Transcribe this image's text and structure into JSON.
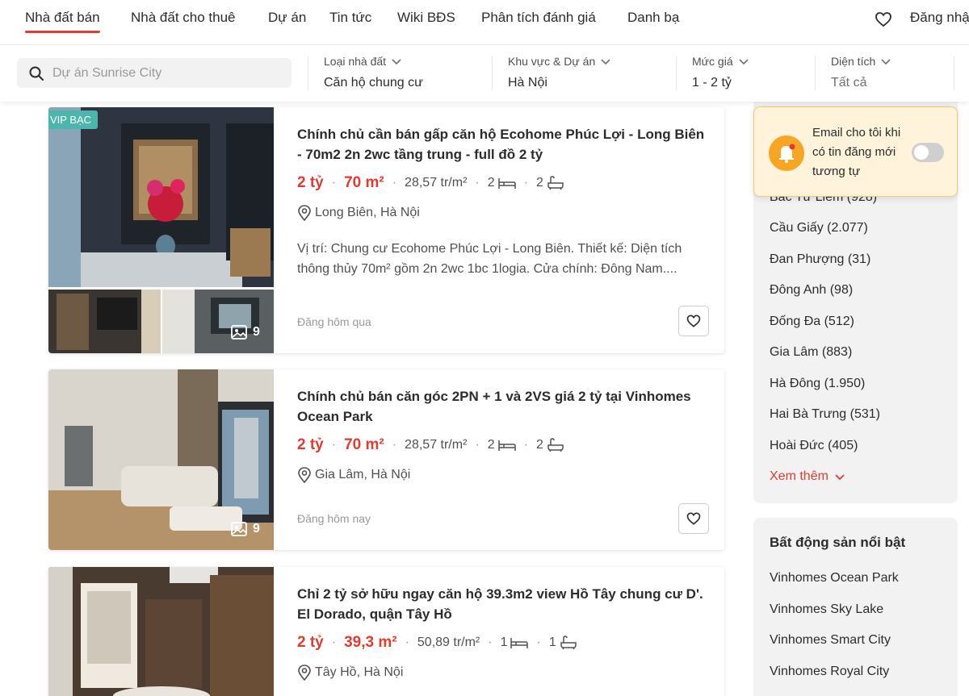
{
  "nav": {
    "items": [
      "Nhà đất bán",
      "Nhà đất cho thuê",
      "Dự án",
      "Tin tức",
      "Wiki BĐS",
      "Phân tích đánh giá",
      "Danh bạ"
    ],
    "active_index": 0,
    "login_label": "Đăng nhậ",
    "heart_icon": "heart-icon"
  },
  "search": {
    "placeholder": "Dự án Sunrise City"
  },
  "filters": [
    {
      "label": "Loại nhà đất",
      "value": "Căn hộ chung cư"
    },
    {
      "label": "Khu vực & Dự án",
      "value": "Hà Nội"
    },
    {
      "label": "Mức giá",
      "value": "1 - 2 tỷ"
    },
    {
      "label": "Diện tích",
      "value": "Tất cả"
    }
  ],
  "listings": [
    {
      "badge": "VIP BẠC",
      "title": "Chính chủ cần bán gấp căn hộ Ecohome Phúc Lợi - Long Biên - 70m2 2n 2wc tầng trung - full đồ 2 tỷ",
      "price": "2 tỷ",
      "area": "70 m²",
      "price_per_m2": "28,57 tr/m²",
      "bedrooms": "2",
      "bathrooms": "2",
      "location": "Long Biên, Hà Nội",
      "description": "Vị trí: Chung cư Ecohome Phúc Lợi - Long Biên. Thiết kế: Diện tích thông thủy 70m² gồm 2n 2wc 1bc 1logia. Cửa chính: Đông Nam....",
      "photo_count": "9",
      "posted": "Đăng hôm qua"
    },
    {
      "title": "Chính chủ bán căn góc 2PN + 1 và 2VS giá 2 tỷ tại Vinhomes Ocean Park",
      "price": "2 tỷ",
      "area": "70 m²",
      "price_per_m2": "28,57 tr/m²",
      "bedrooms": "2",
      "bathrooms": "2",
      "location": "Gia Lâm, Hà Nội",
      "photo_count": "9",
      "posted": "Đăng hôm nay"
    },
    {
      "title": "Chỉ 2 tỷ sở hữu ngay căn hộ 39.3m2 view Hồ Tây chung cư D'. El Dorado, quận Tây Hồ",
      "price": "2 tỷ",
      "area": "39,3 m²",
      "price_per_m2": "50,89 tr/m²",
      "bedrooms": "1",
      "bathrooms": "1",
      "location": "Tây Hồ, Hà Nội"
    }
  ],
  "email_alert": {
    "text": "Email cho tôi khi có tin đăng mới tương tự",
    "enabled": false
  },
  "districts": {
    "items": [
      "Bắc Từ Liêm (928)",
      "Cầu Giấy (2.077)",
      "Đan Phượng (31)",
      "Đông Anh (98)",
      "Đống Đa (512)",
      "Gia Lâm (883)",
      "Hà Đông (1.950)",
      "Hai Bà Trưng (531)",
      "Hoài Đức (405)"
    ],
    "more_label": "Xem thêm"
  },
  "featured": {
    "title": "Bất động sản nổi bật",
    "items": [
      "Vinhomes Ocean Park",
      "Vinhomes Sky Lake",
      "Vinhomes Smart City",
      "Vinhomes Royal City"
    ]
  },
  "colors": {
    "accent": "#e03c31",
    "vip_badge": "#4db6ac",
    "sidebar_bg": "#f2f2f2",
    "email_box": "#fff3dc"
  }
}
